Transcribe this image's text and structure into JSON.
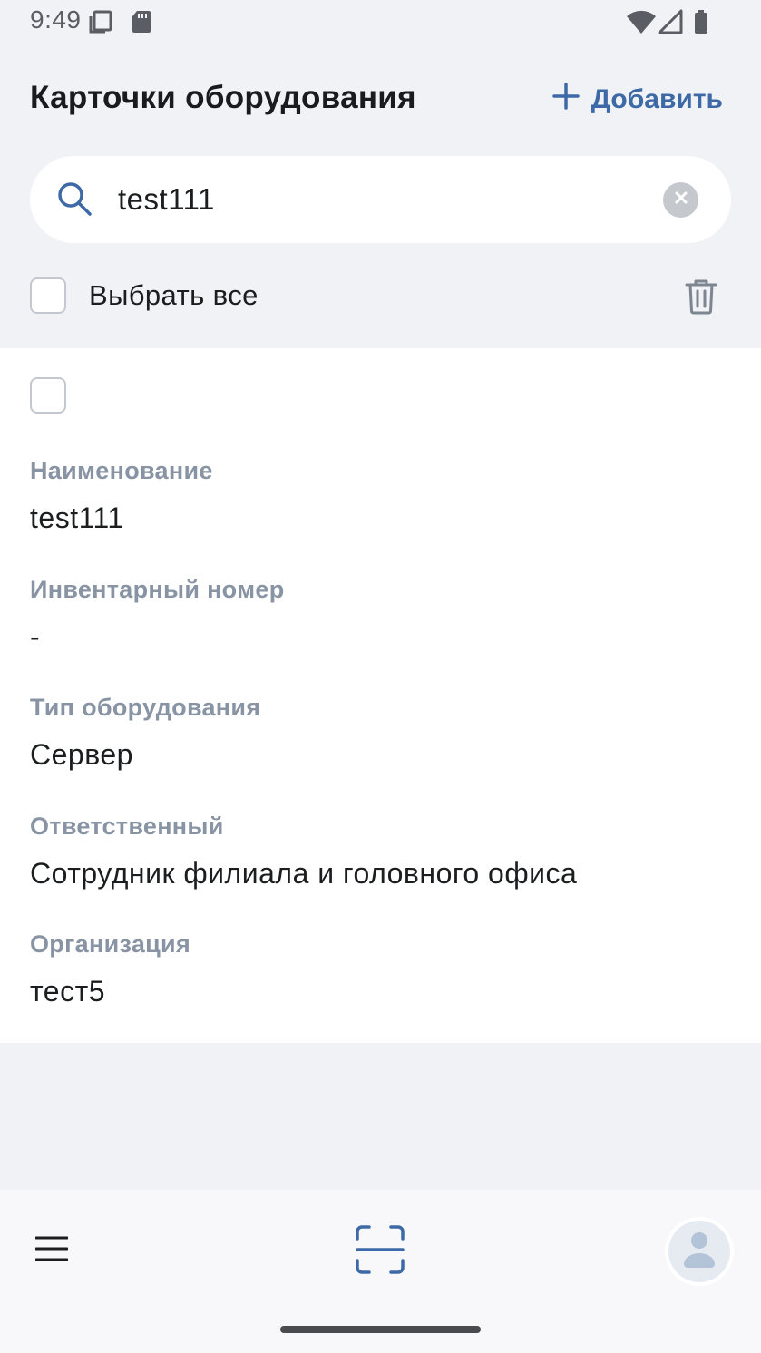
{
  "status_bar": {
    "time": "9:49",
    "icons": [
      "screenshot-icon",
      "sd-card-icon",
      "wifi-icon",
      "cellular-signal-icon",
      "battery-icon"
    ]
  },
  "header": {
    "title": "Карточки оборудования",
    "add_label": "Добавить",
    "add_icon": "plus-icon",
    "accent_color": "#3d6aa6"
  },
  "search": {
    "value": "test111",
    "icon": "search-icon",
    "clear_icon": "clear-icon"
  },
  "select_all": {
    "label": "Выбрать все",
    "checked": false,
    "delete_icon": "trash-icon"
  },
  "cards": [
    {
      "checked": false,
      "fields": [
        {
          "label": "Наименование",
          "value": "test111"
        },
        {
          "label": "Инвентарный номер",
          "value": "-"
        },
        {
          "label": "Тип оборудования",
          "value": "Сервер"
        },
        {
          "label": "Ответственный",
          "value": "Сотрудник филиала и головного офиса"
        },
        {
          "label": "Организация",
          "value": "тест5"
        }
      ]
    }
  ],
  "bottom_nav": {
    "items": [
      "menu-icon",
      "scan-icon",
      "profile-avatar-icon"
    ]
  }
}
